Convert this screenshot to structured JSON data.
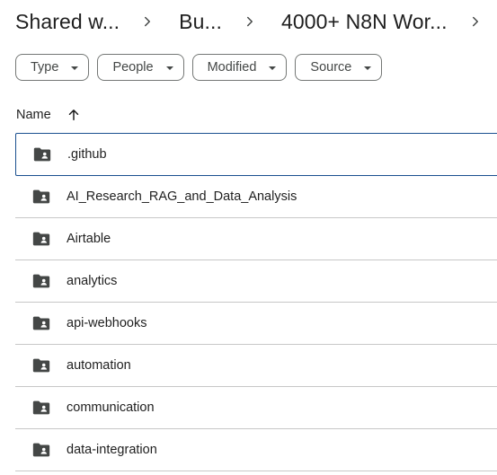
{
  "breadcrumb": {
    "items": [
      {
        "label": "Shared w..."
      },
      {
        "label": "Bu..."
      },
      {
        "label": "4000+ N8N Wor..."
      }
    ]
  },
  "filters": {
    "chips": [
      {
        "label": "Type"
      },
      {
        "label": "People"
      },
      {
        "label": "Modified"
      },
      {
        "label": "Source"
      }
    ]
  },
  "list": {
    "header": {
      "name_label": "Name",
      "sort_direction": "ascending"
    },
    "rows": [
      {
        "name": ".github",
        "icon": "shared-folder-icon",
        "selected": true
      },
      {
        "name": "AI_Research_RAG_and_Data_Analysis",
        "icon": "shared-folder-icon"
      },
      {
        "name": "Airtable",
        "icon": "shared-folder-icon"
      },
      {
        "name": "analytics",
        "icon": "shared-folder-icon"
      },
      {
        "name": "api-webhooks",
        "icon": "shared-folder-icon"
      },
      {
        "name": "automation",
        "icon": "shared-folder-icon"
      },
      {
        "name": "communication",
        "icon": "shared-folder-icon"
      },
      {
        "name": "data-integration",
        "icon": "shared-folder-icon"
      }
    ]
  },
  "colors": {
    "selection_border": "#1a4f8f",
    "divider": "#c7c7c7",
    "icon": "#444746",
    "text": "#1f1f1f"
  }
}
